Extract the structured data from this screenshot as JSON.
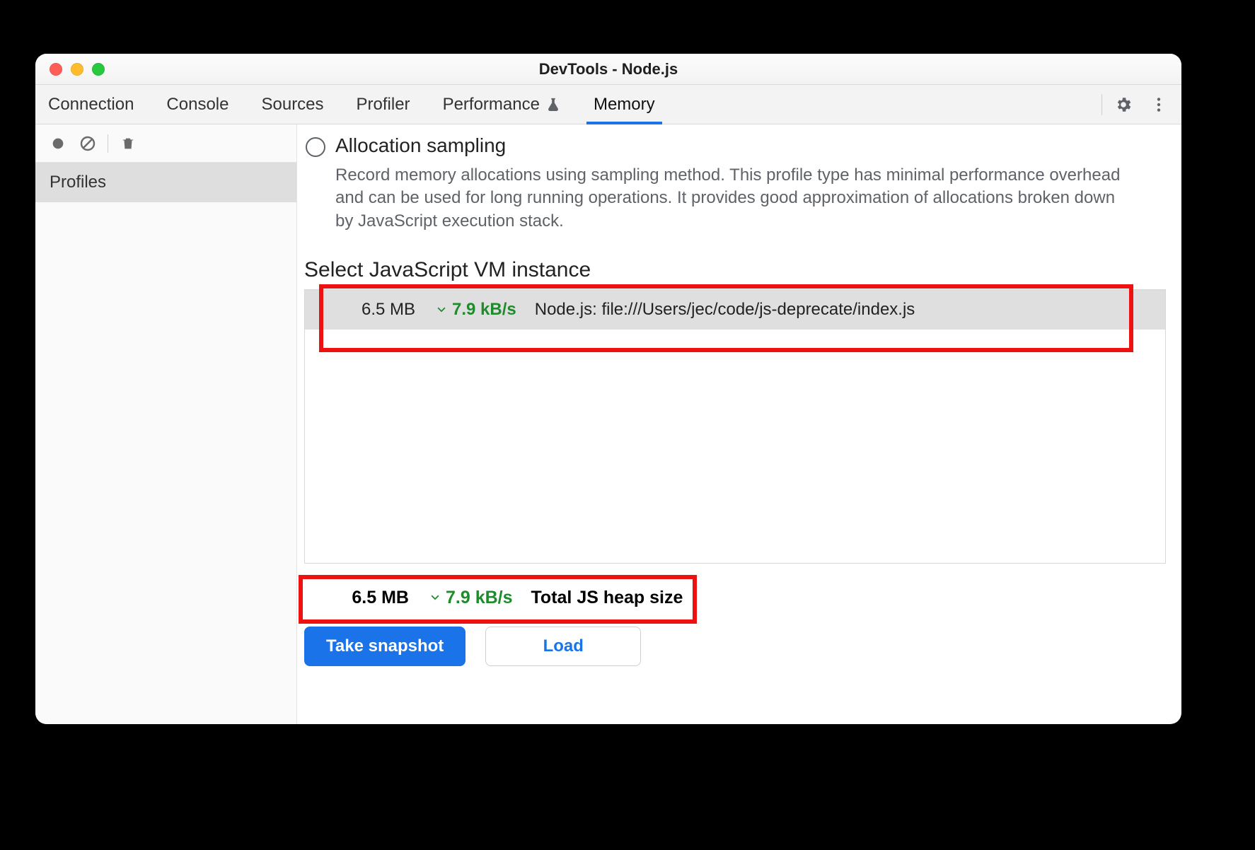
{
  "window": {
    "title": "DevTools - Node.js"
  },
  "tabs": [
    "Connection",
    "Console",
    "Sources",
    "Profiler",
    "Performance",
    "Memory"
  ],
  "activeTab": "Memory",
  "sidebar": {
    "section": "Profiles"
  },
  "profileType": {
    "title": "Allocation sampling",
    "description": "Record memory allocations using sampling method. This profile type has minimal performance overhead and can be used for long running operations. It provides good approximation of allocations broken down by JavaScript execution stack."
  },
  "vm": {
    "heading": "Select JavaScript VM instance",
    "instance": {
      "size": "6.5 MB",
      "rate": "7.9 kB/s",
      "trend": "down",
      "name": "Node.js: file:///Users/jec/code/js-deprecate/index.js"
    }
  },
  "totals": {
    "size": "6.5 MB",
    "rate": "7.9 kB/s",
    "trend": "down",
    "label": "Total JS heap size"
  },
  "actions": {
    "primary": "Take snapshot",
    "secondary": "Load"
  },
  "colors": {
    "accent": "#1a73e8",
    "trend": "#1f8b2d",
    "annotation": "#e11"
  }
}
